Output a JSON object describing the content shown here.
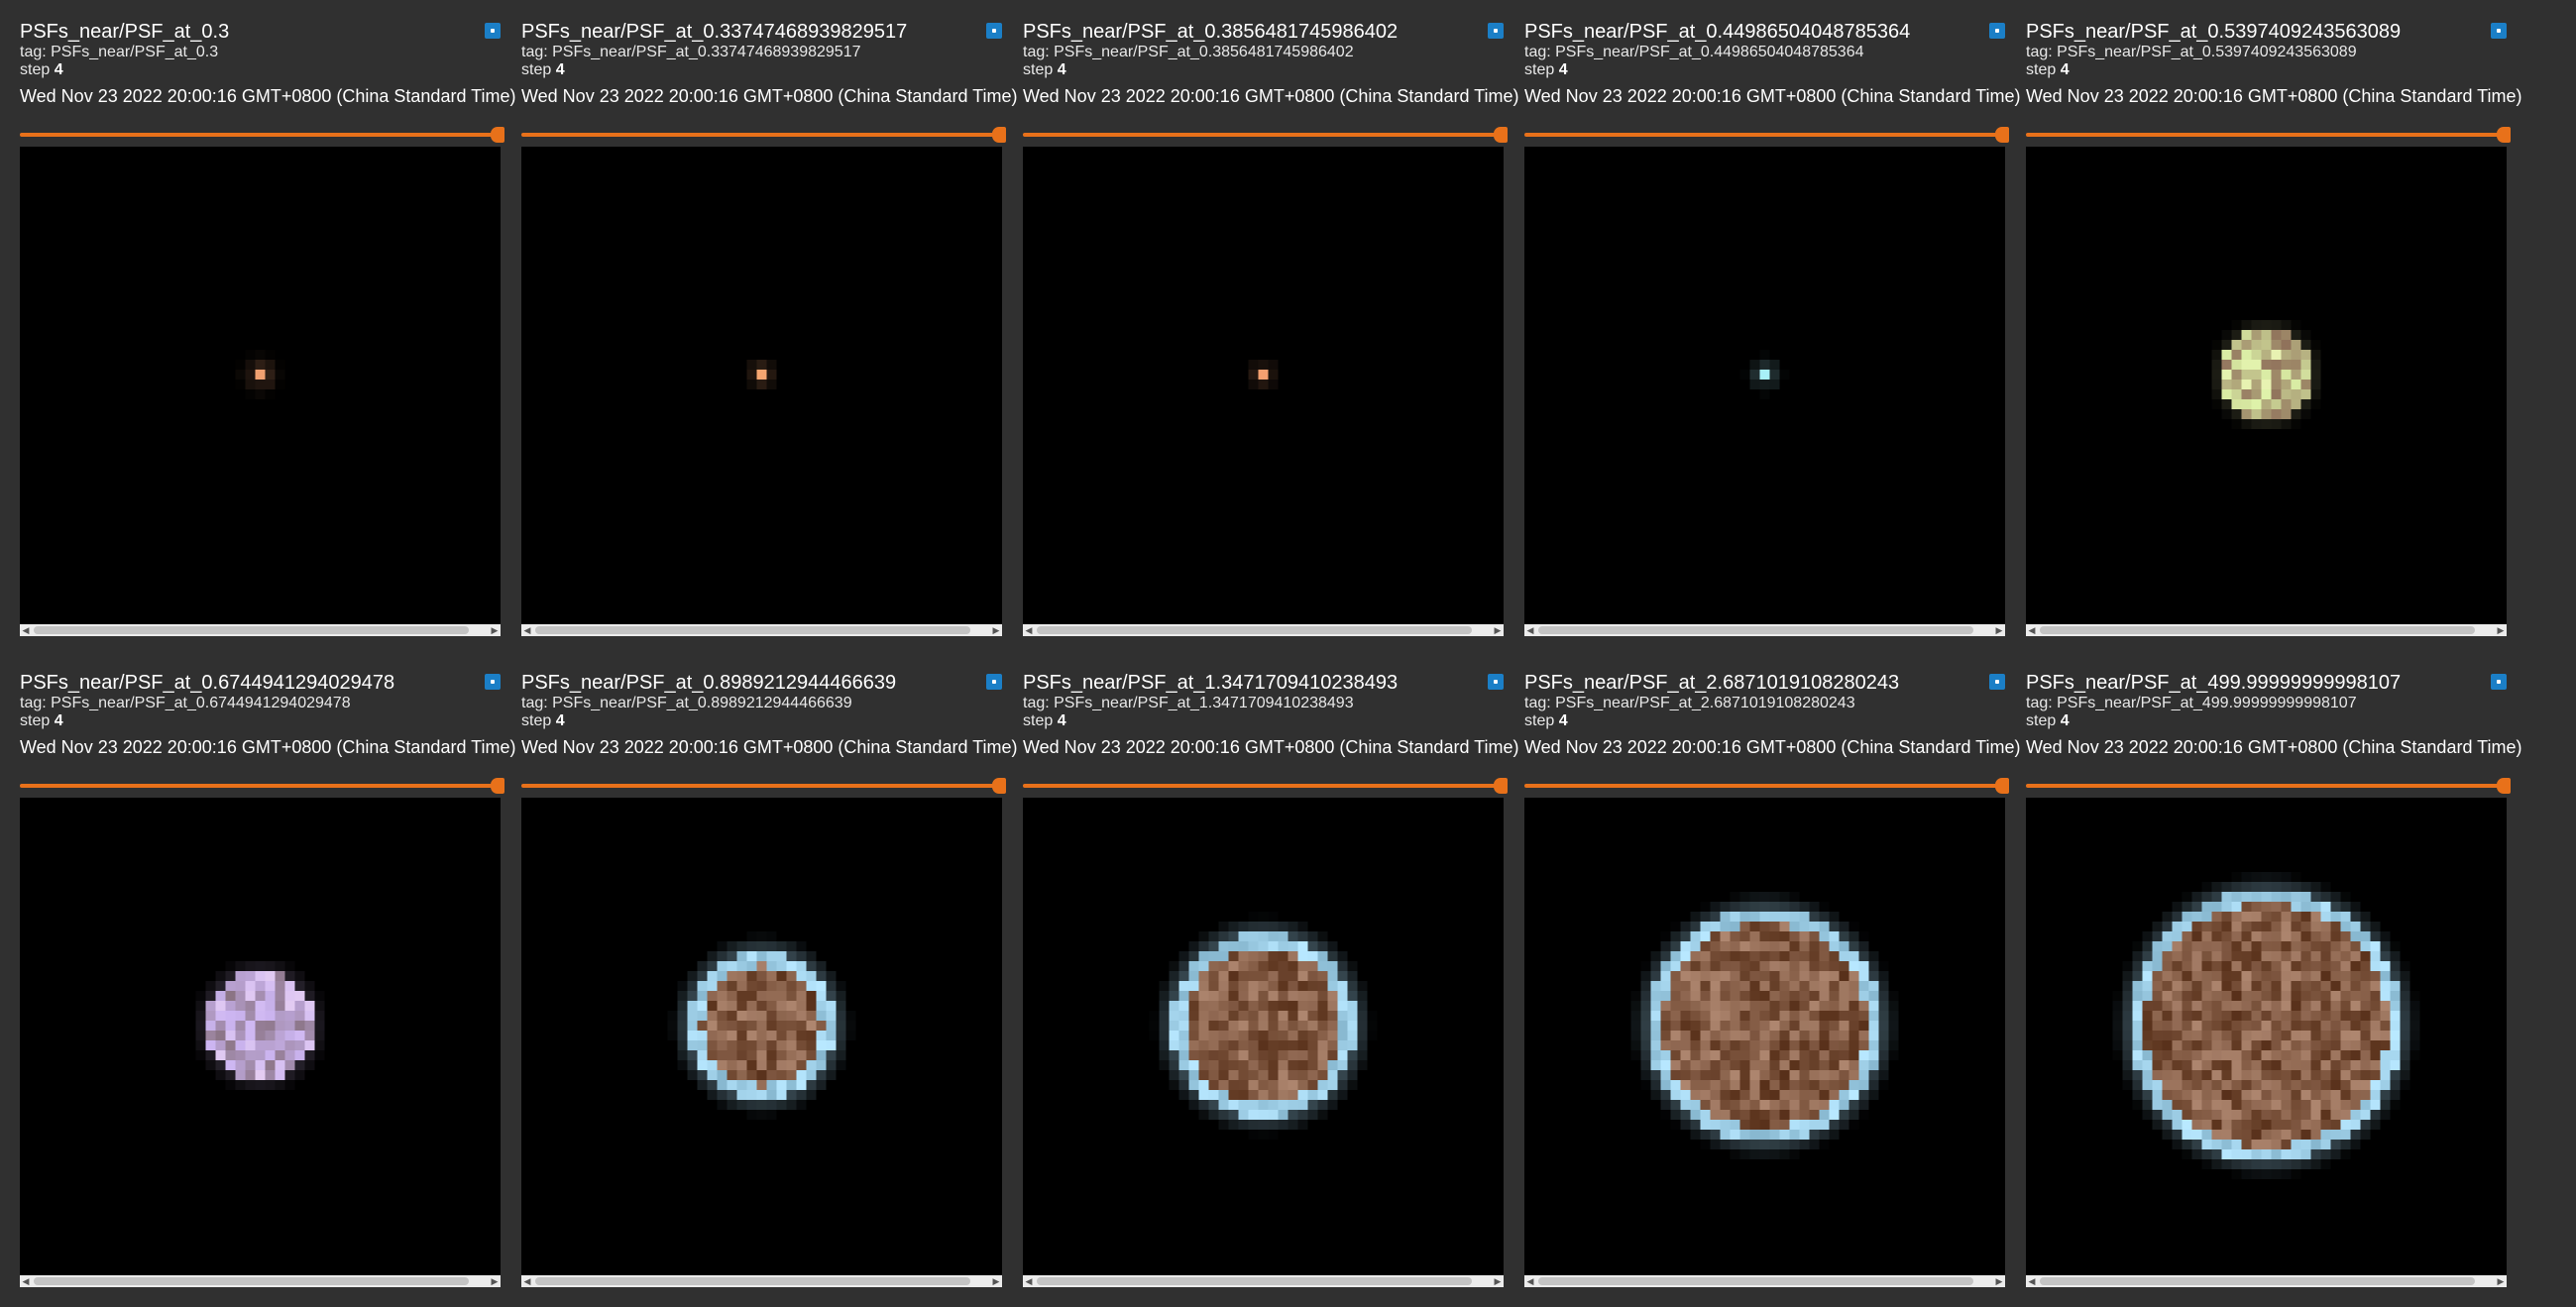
{
  "cards": [
    {
      "title": "PSFs_near/PSF_at_0.3",
      "tag": "tag: PSFs_near/PSF_at_0.3",
      "step_label": "step",
      "step": "4",
      "timestamp": "Wed Nov 23 2022 20:00:16 GMT+0800 (China Standard Time)",
      "psf": {
        "style": "single",
        "r": 0.2,
        "color": "#f0a070"
      }
    },
    {
      "title": "PSFs_near/PSF_at_0.33747468939829517",
      "tag": "tag: PSFs_near/PSF_at_0.33747468939829517",
      "step_label": "step",
      "step": "4",
      "timestamp": "Wed Nov 23 2022 20:00:16 GMT+0800 (China Standard Time)",
      "psf": {
        "style": "single",
        "r": 0.1,
        "color": "#f5a570"
      }
    },
    {
      "title": "PSFs_near/PSF_at_0.3856481745986402",
      "tag": "tag: PSFs_near/PSF_at_0.3856481745986402",
      "step_label": "step",
      "step": "4",
      "timestamp": "Wed Nov 23 2022 20:00:16 GMT+0800 (China Standard Time)",
      "psf": {
        "style": "single",
        "r": 0.05,
        "color": "#f5a070"
      }
    },
    {
      "title": "PSFs_near/PSF_at_0.44986504048785364",
      "tag": "tag: PSFs_near/PSF_at_0.44986504048785364",
      "step_label": "step",
      "step": "4",
      "timestamp": "Wed Nov 23 2022 20:00:16 GMT+0800 (China Standard Time)",
      "psf": {
        "style": "single",
        "r": 0.15,
        "color": "#a8f0f8"
      }
    },
    {
      "title": "PSFs_near/PSF_at_0.5397409243563089",
      "tag": "tag: PSFs_near/PSF_at_0.5397409243563089",
      "step_label": "step",
      "step": "4",
      "timestamp": "Wed Nov 23 2022 20:00:16 GMT+0800 (China Standard Time)",
      "psf": {
        "style": "disk",
        "r": 0.4,
        "color": "#c8c890"
      }
    },
    {
      "title": "PSFs_near/PSF_at_0.6744941294029478",
      "tag": "tag: PSFs_near/PSF_at_0.6744941294029478",
      "step_label": "step",
      "step": "4",
      "timestamp": "Wed Nov 23 2022 20:00:16 GMT+0800 (China Standard Time)",
      "psf": {
        "style": "disk",
        "r": 0.5,
        "color": "#c0a8d8"
      }
    },
    {
      "title": "PSFs_near/PSF_at_0.8989212944466639",
      "tag": "tag: PSFs_near/PSF_at_0.8989212944466639",
      "step_label": "step",
      "step": "4",
      "timestamp": "Wed Nov 23 2022 20:00:16 GMT+0800 (China Standard Time)",
      "psf": {
        "style": "ring",
        "r": 0.7,
        "color": "#b8d0c8"
      }
    },
    {
      "title": "PSFs_near/PSF_at_1.3471709410238493",
      "tag": "tag: PSFs_near/PSF_at_1.3471709410238493",
      "step_label": "step",
      "step": "4",
      "timestamp": "Wed Nov 23 2022 20:00:16 GMT+0800 (China Standard Time)",
      "psf": {
        "style": "ring",
        "r": 0.9,
        "color": "#b0d8e0"
      }
    },
    {
      "title": "PSFs_near/PSF_at_2.6871019108280243",
      "tag": "tag: PSFs_near/PSF_at_2.6871019108280243",
      "step_label": "step",
      "step": "4",
      "timestamp": "Wed Nov 23 2022 20:00:16 GMT+0800 (China Standard Time)",
      "psf": {
        "style": "ring",
        "r": 1.15,
        "color": "#a0d0e8"
      }
    },
    {
      "title": "PSFs_near/PSF_at_499.99999999998107",
      "tag": "tag: PSFs_near/PSF_at_499.99999999998107",
      "step_label": "step",
      "step": "4",
      "timestamp": "Wed Nov 23 2022 20:00:16 GMT+0800 (China Standard Time)",
      "psf": {
        "style": "ring",
        "r": 1.35,
        "color": "#90c8e8"
      }
    }
  ],
  "colors": {
    "background": "#303030",
    "accent_slider": "#e8711a",
    "pin_button": "#1b7fc7",
    "image_background": "#000000",
    "ring_color": "#a0d0e8",
    "core_color": "#8a6048"
  },
  "icons": {
    "pin": "pin-icon",
    "scroll_left": "chevron-left-icon",
    "scroll_right": "chevron-right-icon"
  }
}
